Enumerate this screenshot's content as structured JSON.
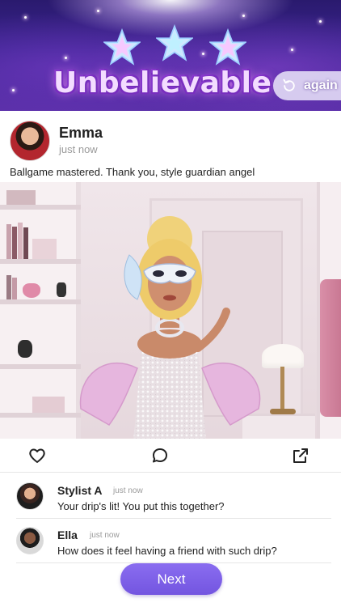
{
  "banner": {
    "title": "Unbelievable",
    "again_label": "again",
    "stars": 3
  },
  "post": {
    "author": "Emma",
    "time": "just now",
    "text": "Ballgame mastered. Thank you, style guardian angel"
  },
  "actions": {
    "like_icon": "heart-icon",
    "comment_icon": "comment-bubble-icon",
    "share_icon": "share-icon"
  },
  "comments": [
    {
      "name": "Stylist A",
      "time": "just now",
      "text": "Your drip's lit! You put this together?"
    },
    {
      "name": "Ella",
      "time": "just now",
      "text": "How does it feel having a friend with such drip?"
    }
  ],
  "next_button": {
    "label": "Next"
  },
  "colors": {
    "accent": "#7a5ce6",
    "banner": "#3b2490"
  }
}
